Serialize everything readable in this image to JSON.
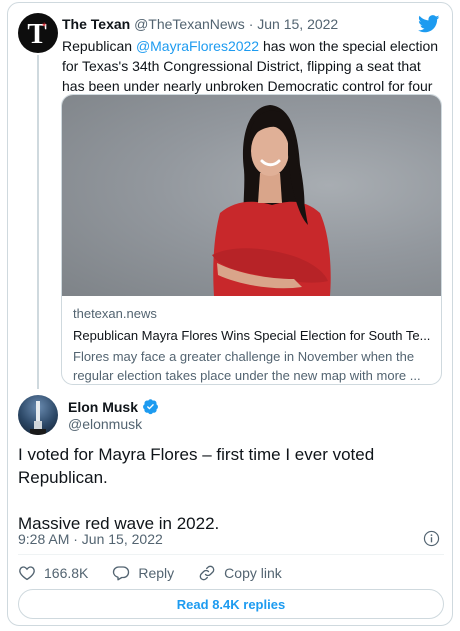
{
  "quoted_tweet": {
    "name": "The Texan",
    "handle": "@TheTexanNews",
    "separator": "·",
    "date": "Jun 15, 2022",
    "avatar_letter": "T",
    "avatar_star": "*",
    "text_before": "Republican ",
    "mention": "@MayraFlores2022",
    "text_after": " has won the special election for Texas's 34th Congressional District, flipping a seat that has been under nearly unbroken Democratic control for four decades.",
    "link_card": {
      "domain": "thetexan.news",
      "title": "Republican Mayra Flores Wins Special Election for South Te...",
      "description": "Flores may face a greater challenge in November when the regular election takes place under the new map with more ..."
    }
  },
  "main_tweet": {
    "name": "Elon Musk",
    "handle": "@elonmusk",
    "text_line1": "I voted for Mayra Flores – first time I ever voted Republican.",
    "text_line2": "Massive red wave in 2022.",
    "timestamp": "9:28 AM · Jun 15, 2022",
    "likes": "166.8K",
    "reply_label": "Reply",
    "copy_link_label": "Copy link",
    "read_replies_label": "Read 8.4K replies"
  },
  "colors": {
    "accent": "#1d9bf0",
    "text": "#0f1419",
    "muted": "#536471",
    "border": "#cfd9de",
    "dress": "#c8282b"
  },
  "icons": {
    "brand": "twitter-bird-icon",
    "verified": "verified-badge-icon",
    "info": "info-icon",
    "like": "heart-icon",
    "reply": "speech-bubble-icon",
    "copy": "link-icon"
  }
}
